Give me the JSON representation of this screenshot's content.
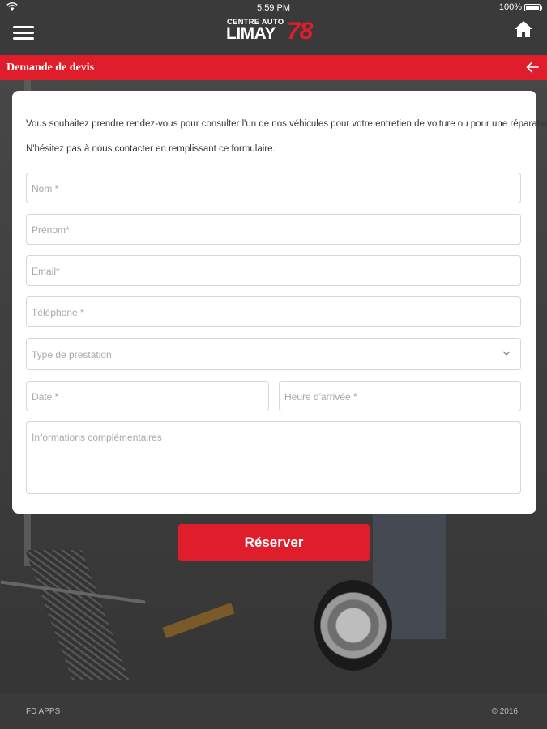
{
  "status_bar": {
    "time": "5:59 PM",
    "battery": "100%",
    "battery_level": 1.0,
    "wifi_icon": "wifi-icon"
  },
  "header": {
    "logo_small": "CENTRE AUTO",
    "logo_big": "LIMAY",
    "logo_number": "78",
    "menu_icon": "hamburger-menu-icon",
    "home_icon": "home-icon"
  },
  "titlebar": {
    "title": "Demande de devis",
    "back_icon": "arrow-left-icon"
  },
  "form": {
    "intro_line1": "Vous souhaitez prendre rendez-vous pour consulter l'un de nos véhicules pour votre entretien de voiture ou pour une réparation?",
    "intro_line2": "N'hésitez pas à nous contacter  en remplissant ce formulaire.",
    "fields": {
      "nom": {
        "placeholder": "Nom *",
        "value": ""
      },
      "prenom": {
        "placeholder": "Prénom*",
        "value": ""
      },
      "email": {
        "placeholder": "Email*",
        "value": ""
      },
      "telephone": {
        "placeholder": "Téléphone *",
        "value": ""
      },
      "prestation": {
        "placeholder": "Type de prestation",
        "value": ""
      },
      "date": {
        "placeholder": "Date *",
        "value": ""
      },
      "heure": {
        "placeholder": "Heure d'arrivée *",
        "value": ""
      },
      "infos": {
        "placeholder": "Informations complémentaires",
        "value": ""
      }
    },
    "submit_label": "Réserver"
  },
  "footer": {
    "left": "FD APPS",
    "right": "© 2016"
  },
  "colors": {
    "accent": "#e01e2b",
    "header_bg": "#3a3a3a"
  }
}
